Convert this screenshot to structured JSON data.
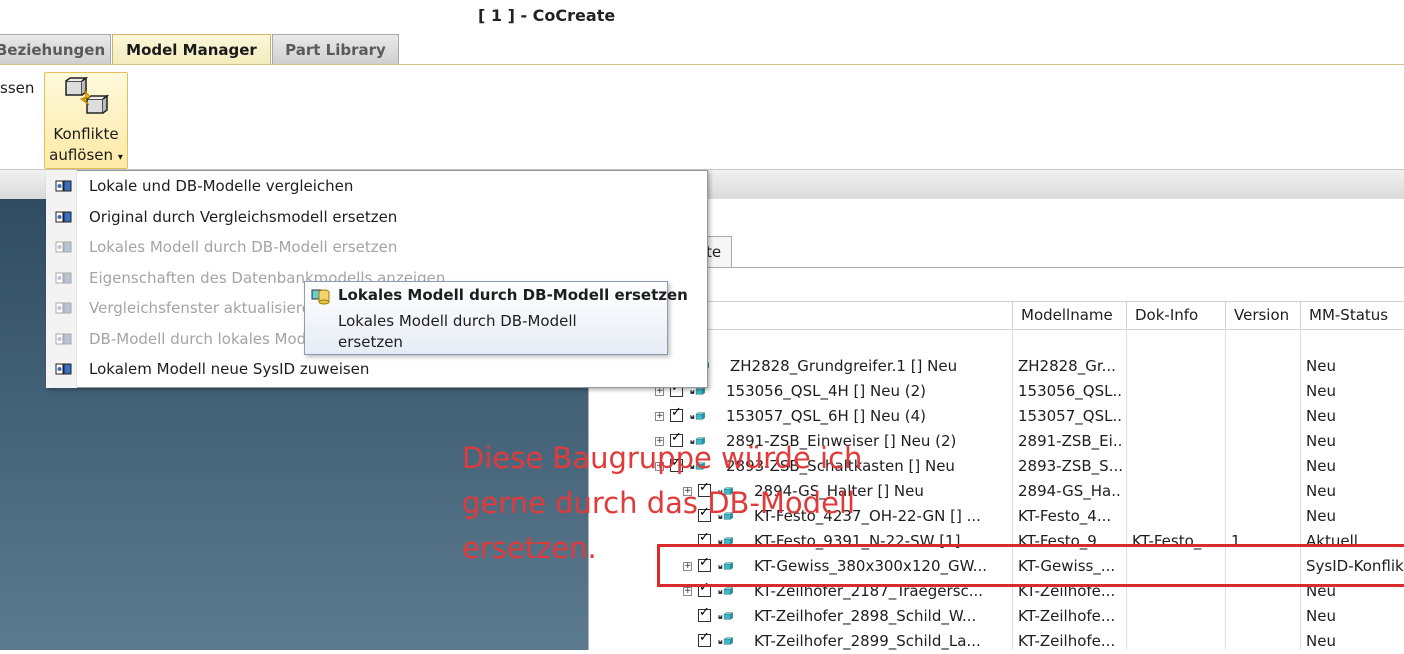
{
  "window": {
    "title": "[ 1 ] - CoCreate"
  },
  "tabs": [
    {
      "label": "Beziehungen"
    },
    {
      "label": "Model Manager"
    },
    {
      "label": "Part Library"
    }
  ],
  "ribbon": {
    "left_label": "ssen",
    "conflict_button": {
      "line1": "Konflikte",
      "line2": "auflösen",
      "arrow": "▾"
    }
  },
  "menu": {
    "items": [
      {
        "label": "Lokale und DB-Modelle vergleichen",
        "enabled": true,
        "icon": "compare-models-icon"
      },
      {
        "label": "Original durch Vergleichsmodell ersetzen",
        "enabled": true,
        "icon": "replace-original-icon"
      },
      {
        "label": "Lokales Modell durch DB-Modell ersetzen",
        "enabled": false,
        "icon": "db-replace-icon"
      },
      {
        "label": "Eigenschaften des Datenbankmodells anzeigen",
        "enabled": false,
        "icon": "db-properties-icon"
      },
      {
        "label": "Vergleichsfenster aktualisieren",
        "enabled": false,
        "icon": "refresh-compare-icon"
      },
      {
        "label": "DB-Modell durch lokales Modell ersetzen",
        "enabled": false,
        "icon": "local-replace-icon"
      },
      {
        "label": "Lokalem Modell neue SysID zuweisen",
        "enabled": true,
        "icon": "new-sysid-icon"
      }
    ]
  },
  "tooltip": {
    "title": "Lokales Modell durch DB-Modell ersetzen",
    "body": "Lokales Modell durch DB-Modell ersetzen"
  },
  "browser": {
    "tab_label": "te",
    "columns": [
      {
        "label": ""
      },
      {
        "label": "Modellname"
      },
      {
        "label": "Dok-Info"
      },
      {
        "label": "Version"
      },
      {
        "label": "MM-Status"
      }
    ],
    "rows": [
      {
        "name": "ZH2828_Grundgreifer.1 [] Neu",
        "model": "ZH2828_Gr...",
        "dok": "",
        "version": "",
        "status": "Neu",
        "indent": 0,
        "check": false,
        "expander": false
      },
      {
        "name": "153056_QSL_4H [] Neu (2)",
        "model": "153056_QSL...",
        "dok": "",
        "version": "",
        "status": "Neu",
        "indent": 1,
        "check": true,
        "expander": true
      },
      {
        "name": "153057_QSL_6H [] Neu (4)",
        "model": "153057_QSL...",
        "dok": "",
        "version": "",
        "status": "Neu",
        "indent": 1,
        "check": true,
        "expander": true
      },
      {
        "name": "2891-ZSB_Einweiser [] Neu (2)",
        "model": "2891-ZSB_Ei...",
        "dok": "",
        "version": "",
        "status": "Neu",
        "indent": 1,
        "check": true,
        "expander": true
      },
      {
        "name": "2893-ZSB_Schaltkasten [] Neu",
        "model": "2893-ZSB_S...",
        "dok": "",
        "version": "",
        "status": "Neu",
        "indent": 1,
        "check": true,
        "expander": true
      },
      {
        "name": "2894-GS_Halter [] Neu",
        "model": "2894-GS_Ha...",
        "dok": "",
        "version": "",
        "status": "Neu",
        "indent": 2,
        "check": true,
        "expander": true
      },
      {
        "name": "KT-Festo_4237_OH-22-GN [] ...",
        "model": "KT-Festo_4...",
        "dok": "",
        "version": "",
        "status": "Neu",
        "indent": 2,
        "check": true,
        "expander": false
      },
      {
        "name": "KT-Festo_9391_N-22-SW [1] ...",
        "model": "KT-Festo_9...",
        "dok": "KT-Festo_...",
        "version": "1",
        "status": "Aktuell",
        "indent": 2,
        "check": true,
        "expander": false
      },
      {
        "name": "KT-Gewiss_380x300x120_GW...",
        "model": "KT-Gewiss_...",
        "dok": "",
        "version": "",
        "status": "SysID-Konflikt",
        "indent": 2,
        "check": true,
        "expander": true
      },
      {
        "name": "KT-Zeilhofer_2187_Traegersc...",
        "model": "KT-Zeilhofe...",
        "dok": "",
        "version": "",
        "status": "Neu",
        "indent": 2,
        "check": true,
        "expander": true
      },
      {
        "name": "KT-Zeilhofer_2898_Schild_W...",
        "model": "KT-Zeilhofe...",
        "dok": "",
        "version": "",
        "status": "Neu",
        "indent": 2,
        "check": true,
        "expander": false
      },
      {
        "name": "KT-Zeilhofer_2899_Schild_La...",
        "model": "KT-Zeilhofe...",
        "dok": "",
        "version": "",
        "status": "Neu",
        "indent": 2,
        "check": true,
        "expander": false
      }
    ]
  },
  "annotation": {
    "line1": "Diese Baugruppe würde ich",
    "line2": "gerne durch das DB-Modell",
    "line3": "ersetzen.",
    "color": "#e03a3a"
  }
}
